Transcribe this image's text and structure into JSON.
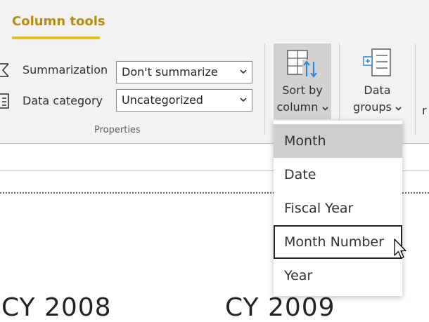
{
  "ribbon": {
    "tab_label": "Column tools",
    "properties": {
      "summarization_label": "Summarization",
      "summarization_value": "Don't summarize",
      "category_label": "Data category",
      "category_value": "Uncategorized",
      "group_label": "Properties"
    },
    "sort_button": {
      "line1": "Sort by",
      "line2": "column"
    },
    "groups_button": {
      "line1": "Data",
      "line2": "groups"
    },
    "clipped_next": "r"
  },
  "menu": {
    "items": [
      {
        "label": "Month",
        "state": "selected"
      },
      {
        "label": "Date",
        "state": "normal"
      },
      {
        "label": "Fiscal Year",
        "state": "normal"
      },
      {
        "label": "Month Number",
        "state": "hover"
      },
      {
        "label": "Year",
        "state": "normal"
      }
    ]
  },
  "visual": {
    "years": [
      "CY 2008",
      "CY 2009"
    ]
  },
  "colors": {
    "accent": "#b58d11",
    "underline": "#e8c21a",
    "selected": "#d0cecc"
  }
}
